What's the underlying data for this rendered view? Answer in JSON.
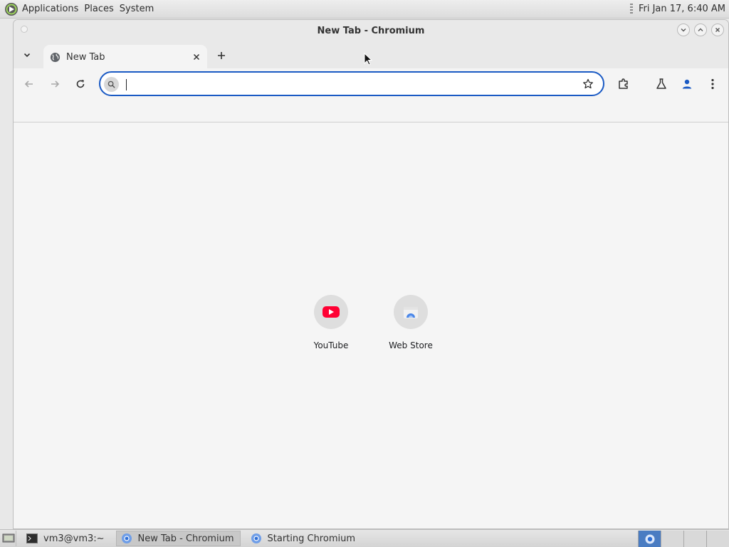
{
  "top_panel": {
    "menus": [
      "Applications",
      "Places",
      "System"
    ],
    "clock": "Fri Jan 17,  6:40 AM"
  },
  "window": {
    "title": "New Tab - Chromium"
  },
  "tab": {
    "title": "New Tab"
  },
  "omnibox": {
    "value": "",
    "placeholder": ""
  },
  "shortcuts": [
    {
      "label": "YouTube",
      "icon": "youtube-icon"
    },
    {
      "label": "Web Store",
      "icon": "web-store-icon"
    }
  ],
  "taskbar": {
    "tasks": [
      {
        "label": "vm3@vm3:~",
        "icon": "terminal-icon"
      },
      {
        "label": "New Tab - Chromium",
        "icon": "chromium-icon"
      },
      {
        "label": "Starting Chromium",
        "icon": "chromium-icon"
      }
    ]
  },
  "colors": {
    "omnibox_border": "#1a5ac4",
    "youtube_red": "#ff0033",
    "profile_blue": "#1a5ac4",
    "workspace_active": "#4a7cc2"
  }
}
